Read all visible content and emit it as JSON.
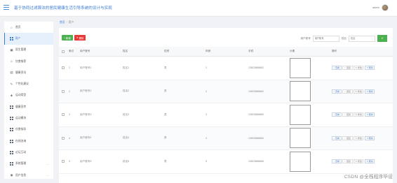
{
  "header": {
    "title": "基于协同过滤算法的居民健康生活引导系统的设计与实现",
    "username": "admin"
  },
  "sidebar": {
    "items": [
      {
        "label": "首页",
        "icon": "home-icon",
        "active": false,
        "expandable": false
      },
      {
        "label": "用户",
        "icon": "grid-icon",
        "active": true,
        "expandable": false
      },
      {
        "label": "医生管理",
        "icon": "doctor-icon",
        "active": false,
        "expandable": false
      },
      {
        "label": "饮食推荐",
        "icon": "food-icon",
        "active": false,
        "expandable": false
      },
      {
        "label": "健康资讯",
        "icon": "news-icon",
        "active": false,
        "expandable": false
      },
      {
        "label": "个性化建议",
        "icon": "advice-icon",
        "active": false,
        "expandable": false
      },
      {
        "label": "运动类型",
        "icon": "sport-icon",
        "active": false,
        "expandable": false
      },
      {
        "label": "健康宣传",
        "icon": "grid-icon",
        "active": false,
        "expandable": false
      },
      {
        "label": "运动模块",
        "icon": "grid-icon",
        "active": false,
        "expandable": false
      },
      {
        "label": "饮食指导",
        "icon": "grid-icon",
        "active": false,
        "expandable": false
      },
      {
        "label": "在线咨询",
        "icon": "grid-icon",
        "active": false,
        "expandable": false
      },
      {
        "label": "论坛互动",
        "icon": "grid-icon",
        "active": false,
        "expandable": false
      },
      {
        "label": "系统管理",
        "icon": "grid-icon",
        "active": false,
        "expandable": true
      },
      {
        "label": "用户信息",
        "icon": "user-info-icon",
        "active": false,
        "expandable": true
      }
    ]
  },
  "breadcrumb": {
    "home": "首页",
    "separator": "/",
    "current": "用户"
  },
  "toolbar": {
    "add_label": "+ 新增",
    "delete_label": "删除"
  },
  "search": {
    "account_label": "用户账号",
    "account_placeholder": "用户账号",
    "name_label": "姓名",
    "name_placeholder": "姓名",
    "button_icon": "search-icon"
  },
  "table": {
    "columns": [
      "索引",
      "用户账号",
      "姓名",
      "性别",
      "年龄",
      "手机",
      "头像",
      "操作"
    ],
    "rows": [
      {
        "index": "1",
        "account": "用户账号1",
        "name": "姓名1",
        "sex": "男",
        "age": "1",
        "phone": "13823888881"
      },
      {
        "index": "2",
        "account": "用户账号2",
        "name": "姓名2",
        "sex": "男",
        "age": "2",
        "phone": "13823888882"
      },
      {
        "index": "3",
        "account": "用户账号3",
        "name": "姓名3",
        "sex": "男",
        "age": "3",
        "phone": "13823888883"
      },
      {
        "index": "4",
        "account": "用户账号4",
        "name": "姓名4",
        "sex": "男",
        "age": "4",
        "phone": "13823888884"
      },
      {
        "index": "5",
        "account": "用户账号5",
        "name": "姓名5",
        "sex": "男",
        "age": "5",
        "phone": "13823888885"
      }
    ],
    "ops": {
      "view": "查看",
      "reply": "回复",
      "edit": "修改",
      "delete": "删除"
    }
  },
  "watermark": "CSDN @全栈程序毕设",
  "colors": {
    "accent": "#3a7bd5",
    "add": "#4caf50",
    "delete": "#e53935"
  }
}
